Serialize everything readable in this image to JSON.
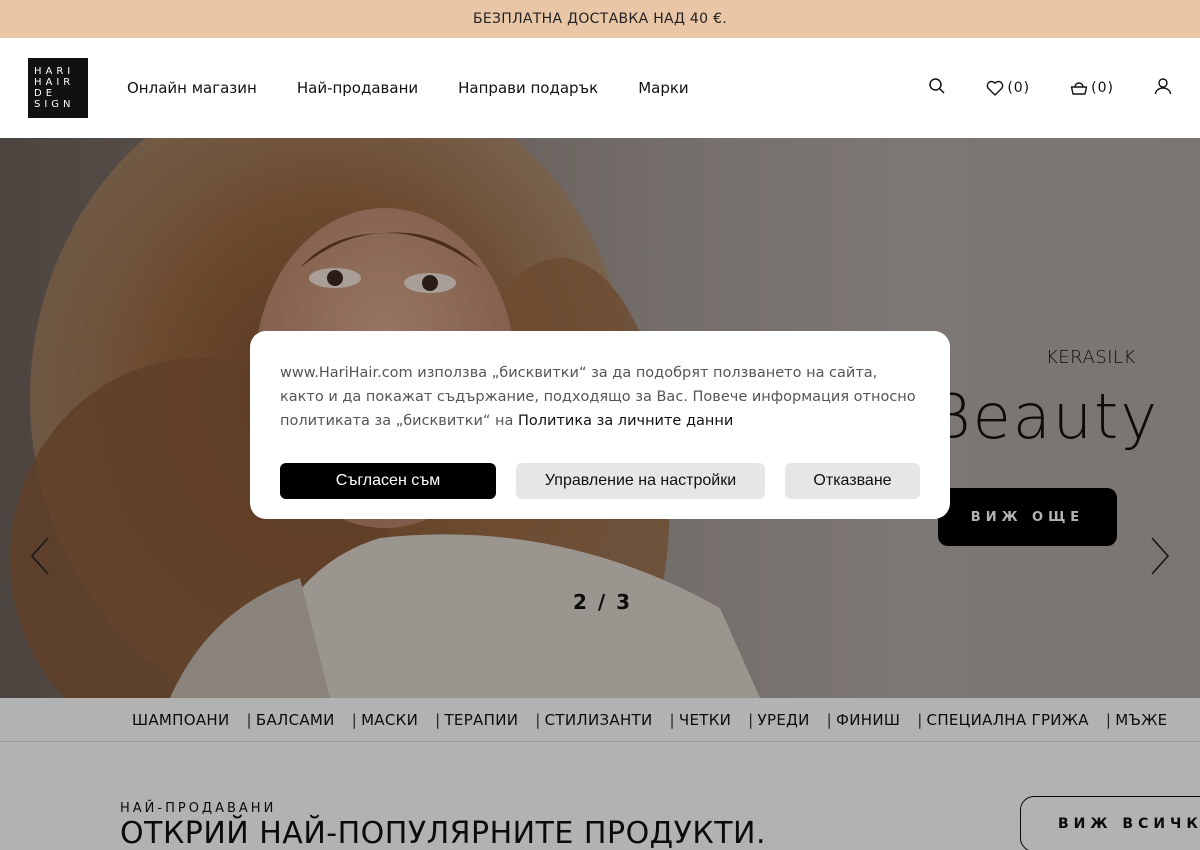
{
  "promo": {
    "text": "БЕЗПЛАТНА ДОСТАВКА НАД 40 €."
  },
  "header": {
    "logo_lines": [
      "HARI",
      "HAIR",
      "DE",
      "SIGN"
    ],
    "nav": [
      "Онлайн магазин",
      "Най-продавани",
      "Направи подарък",
      "Марки"
    ],
    "wishlist_count": "(0)",
    "cart_count": "(0)"
  },
  "hero": {
    "brand": "KERASILK",
    "title": "Beauty",
    "cta": "ВИЖ ОЩЕ",
    "counter": "2 / 3"
  },
  "categories": [
    "ШАМПОАНИ",
    "БАЛСАМИ",
    "МАСКИ",
    "ТЕРАПИИ",
    "СТИЛИЗАНТИ",
    "ЧЕТКИ",
    "УРЕДИ",
    "ФИНИШ",
    "СПЕЦИАЛНА ГРИЖА",
    "МЪЖЕ"
  ],
  "bestsellers": {
    "eyebrow": "НАЙ-ПРОДАВАНИ",
    "title": "ОТКРИЙ НАЙ-ПОПУЛЯРНИТЕ ПРОДУКТИ.",
    "button": "ВИЖ ВСИЧКИ"
  },
  "cookie": {
    "text": "www.HariHair.com използва „бисквитки“ за да подобрят ползването на сайта, както и да покажат съдържание, подходящо за Вас. Повече информация относно политиката за „бисквитки“ на",
    "link": "Политика за личните данни",
    "accept": "Съгласен съм",
    "manage": "Управление на настройки",
    "decline": "Отказване"
  },
  "colors": {
    "promo_bg": "#e8c6a6",
    "primary": "#000000",
    "overlay": "rgba(0,0,0,0.30)"
  }
}
